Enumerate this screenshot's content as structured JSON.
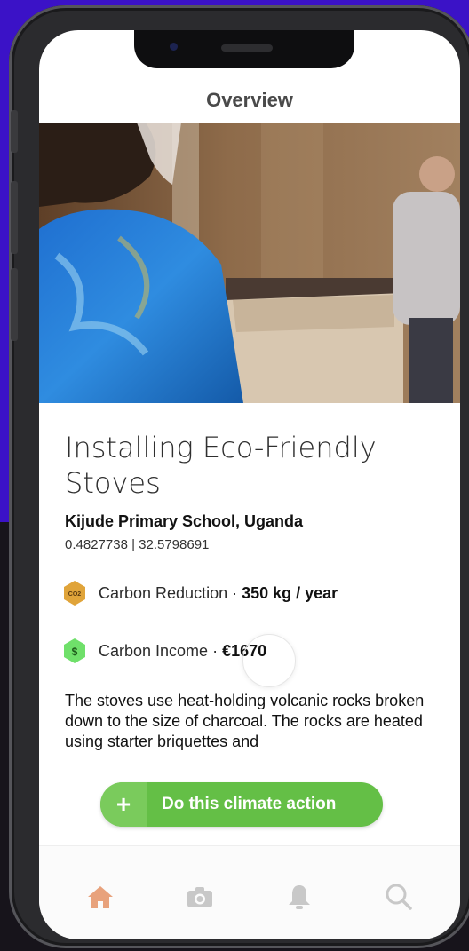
{
  "header": {
    "title": "Overview"
  },
  "project": {
    "title": "Installing Eco-Friendly Stoves",
    "location": "Kijude Primary School, Uganda",
    "coordinates": "0.4827738 | 32.5798691"
  },
  "metrics": {
    "reduction": {
      "icon": "co2-badge-icon",
      "badge_text": "CO2",
      "label": "Carbon Reduction · ",
      "value": "350 kg / year"
    },
    "income": {
      "icon": "dollar-badge-icon",
      "badge_text": "$",
      "label": "Carbon Income · ",
      "value": "€1670"
    }
  },
  "description": "The stoves use heat-holding volcanic rocks broken down to the size of charcoal. The rocks are heated using starter briquettes and",
  "cta": {
    "icon": "plus-icon",
    "label": "Do this climate action"
  },
  "tabs": [
    {
      "icon": "home-icon",
      "active": true
    },
    {
      "icon": "camera-icon",
      "active": false
    },
    {
      "icon": "bell-icon",
      "active": false
    },
    {
      "icon": "search-icon",
      "active": false
    }
  ],
  "colors": {
    "background_top": "#3b12c7",
    "cta_green": "#64bf46",
    "active_tab": "#e8a27c",
    "inactive_tab": "#c8c8c8",
    "co2_badge": "#e0a43a",
    "income_badge": "#6fe06a"
  }
}
